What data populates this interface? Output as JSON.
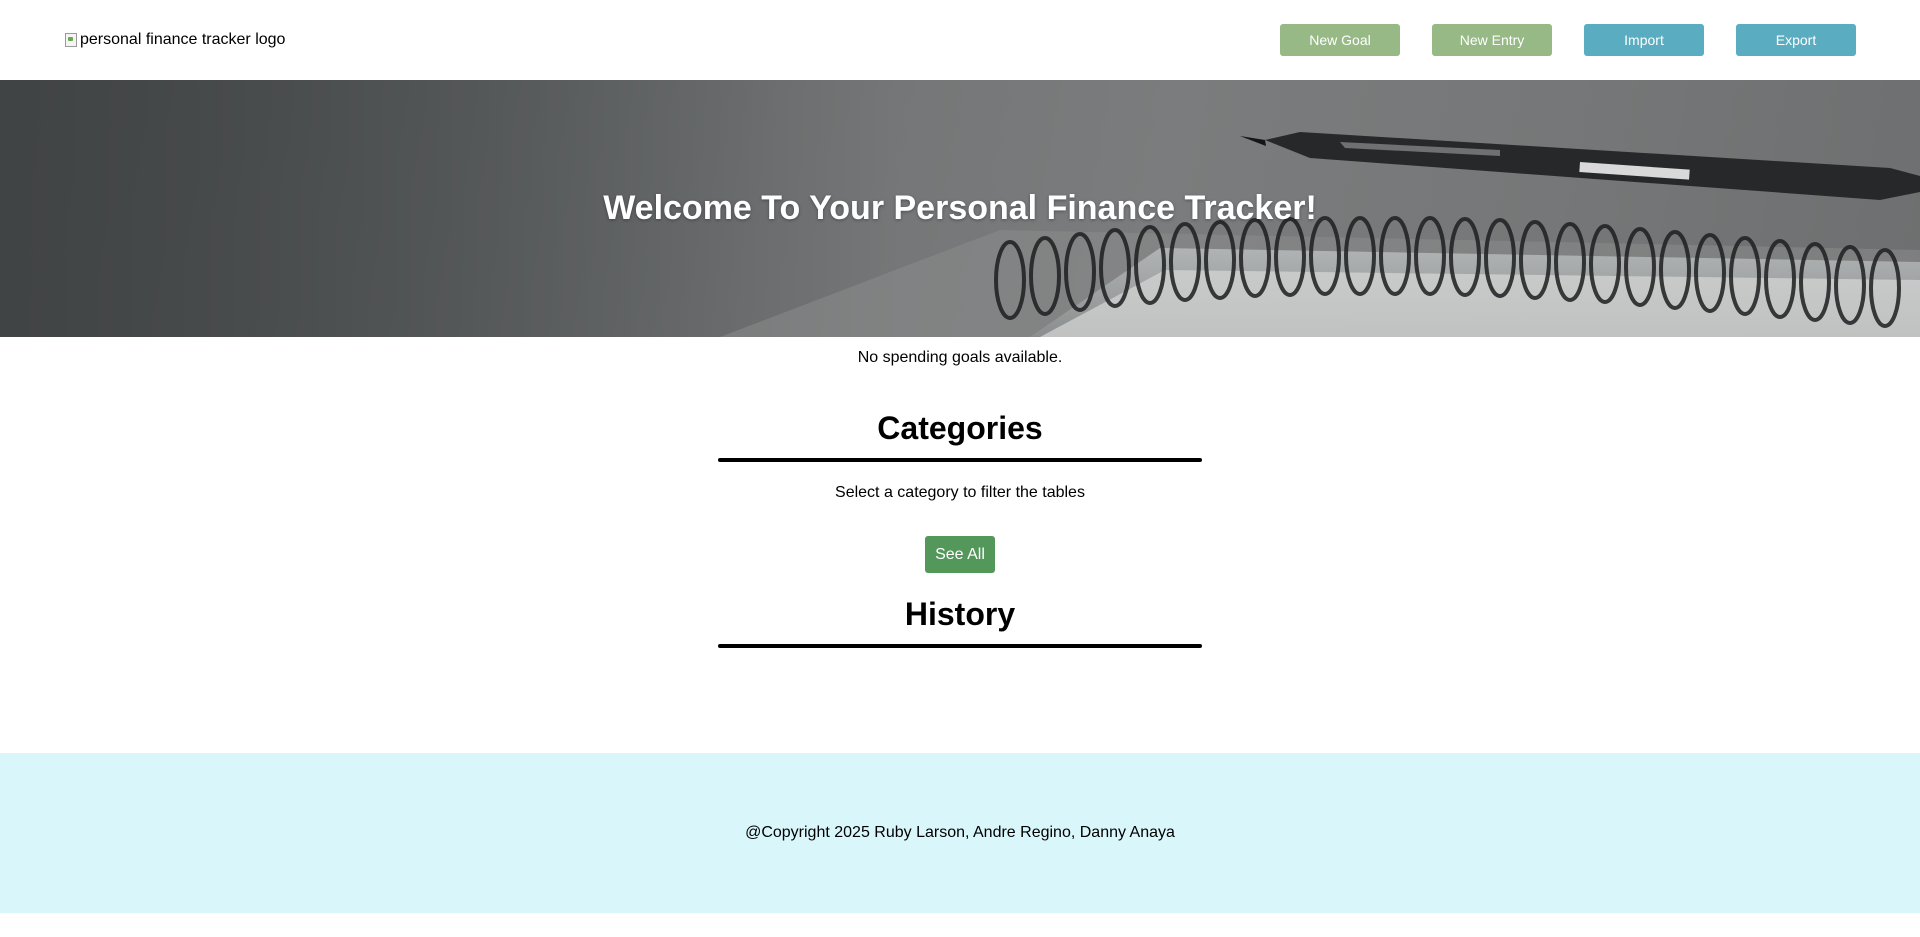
{
  "header": {
    "logo_alt": "personal finance tracker logo",
    "buttons": {
      "new_goal": "New Goal",
      "new_entry": "New Entry",
      "import": "Import",
      "export": "Export"
    }
  },
  "hero": {
    "title": "Welcome To Your Personal Finance Tracker!"
  },
  "goals": {
    "empty_message": "No spending goals available."
  },
  "categories": {
    "title": "Categories",
    "hint": "Select a category to filter the tables",
    "see_all_label": "See All"
  },
  "history": {
    "title": "History"
  },
  "footer": {
    "copyright": "@Copyright 2025 Ruby Larson, Andre Regino, Danny Anaya"
  },
  "colors": {
    "button_green": "#96b985",
    "button_blue": "#5aadc0",
    "see_all_green": "#54975a",
    "footer_bg": "#d9f6fb"
  }
}
